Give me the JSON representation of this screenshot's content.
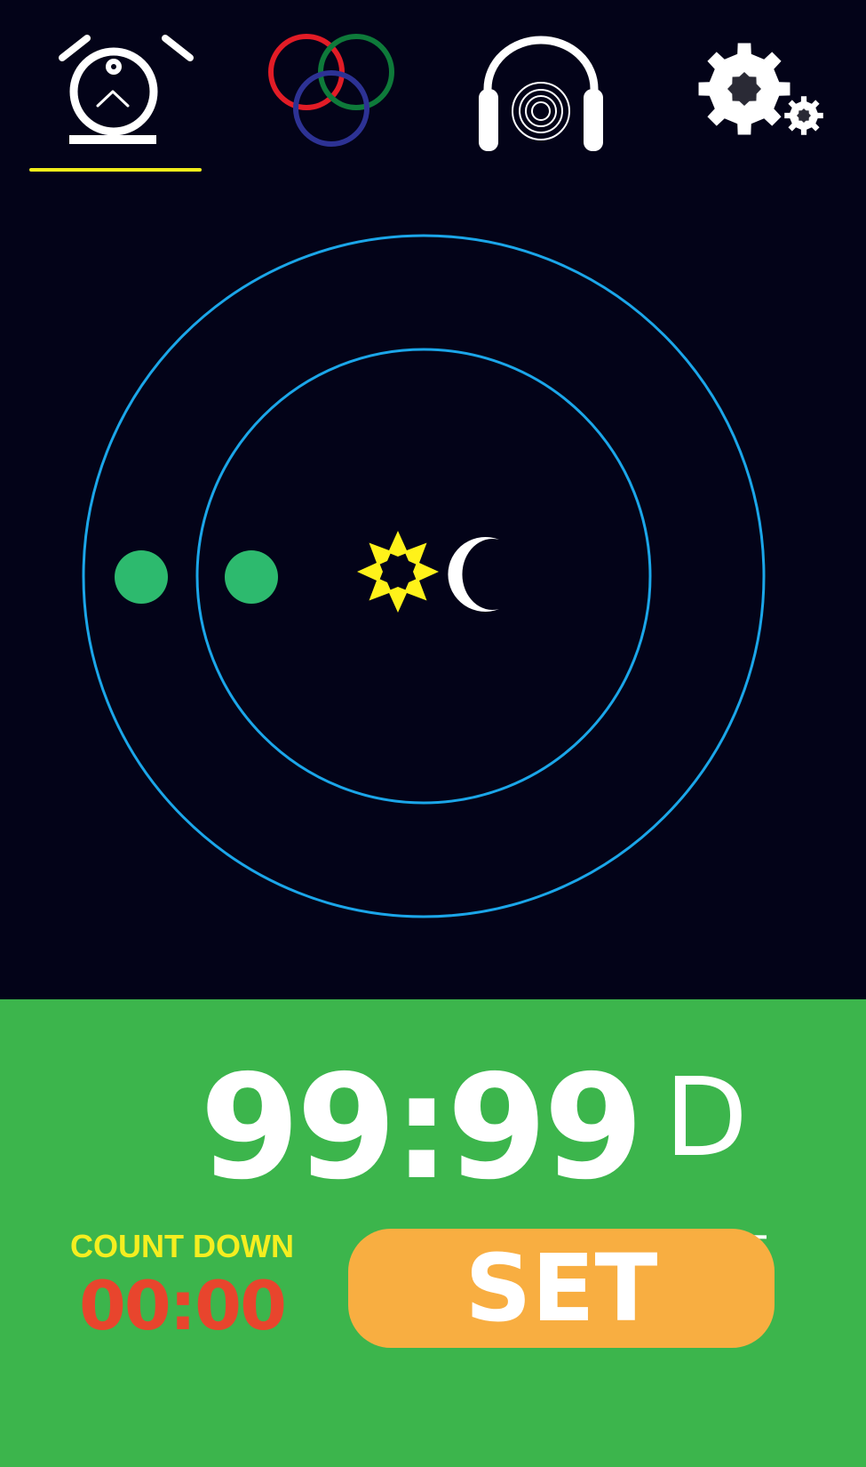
{
  "colors": {
    "background": "#030318",
    "panel": "#3cb54c",
    "ring": "#1ba6e9",
    "marker": "#2dba6e",
    "sun": "#fff21a",
    "moon": "#ffffff",
    "accent_underline": "#f2ee1a",
    "countdown_label": "#f5ee20",
    "countdown_value": "#e8452d",
    "set_button_bg": "#f8ae41",
    "set_button_text": "#ffffff",
    "ring_red": "#e21c26",
    "ring_green": "#0e7a3a",
    "ring_blue": "#2d3294"
  },
  "nav": {
    "tabs": [
      {
        "id": "alarm",
        "icon": "alarm-clock-icon",
        "active": true
      },
      {
        "id": "color",
        "icon": "rgb-rings-icon",
        "active": false
      },
      {
        "id": "sound",
        "icon": "headphones-icon",
        "active": false
      },
      {
        "id": "settings",
        "icon": "gears-icon",
        "active": false
      }
    ]
  },
  "dial": {
    "outer_ring_icon": "outer-ring",
    "inner_ring_icon": "inner-ring",
    "center_icons": [
      "sun-icon",
      "crescent-moon-icon"
    ],
    "marker_icons": [
      "outer-marker-dot",
      "inner-marker-dot"
    ]
  },
  "timer": {
    "display": "99:99",
    "unit": "D"
  },
  "countdown": {
    "label": "COUNT DOWN",
    "value": "00:00"
  },
  "set_button": {
    "label": "SET"
  }
}
